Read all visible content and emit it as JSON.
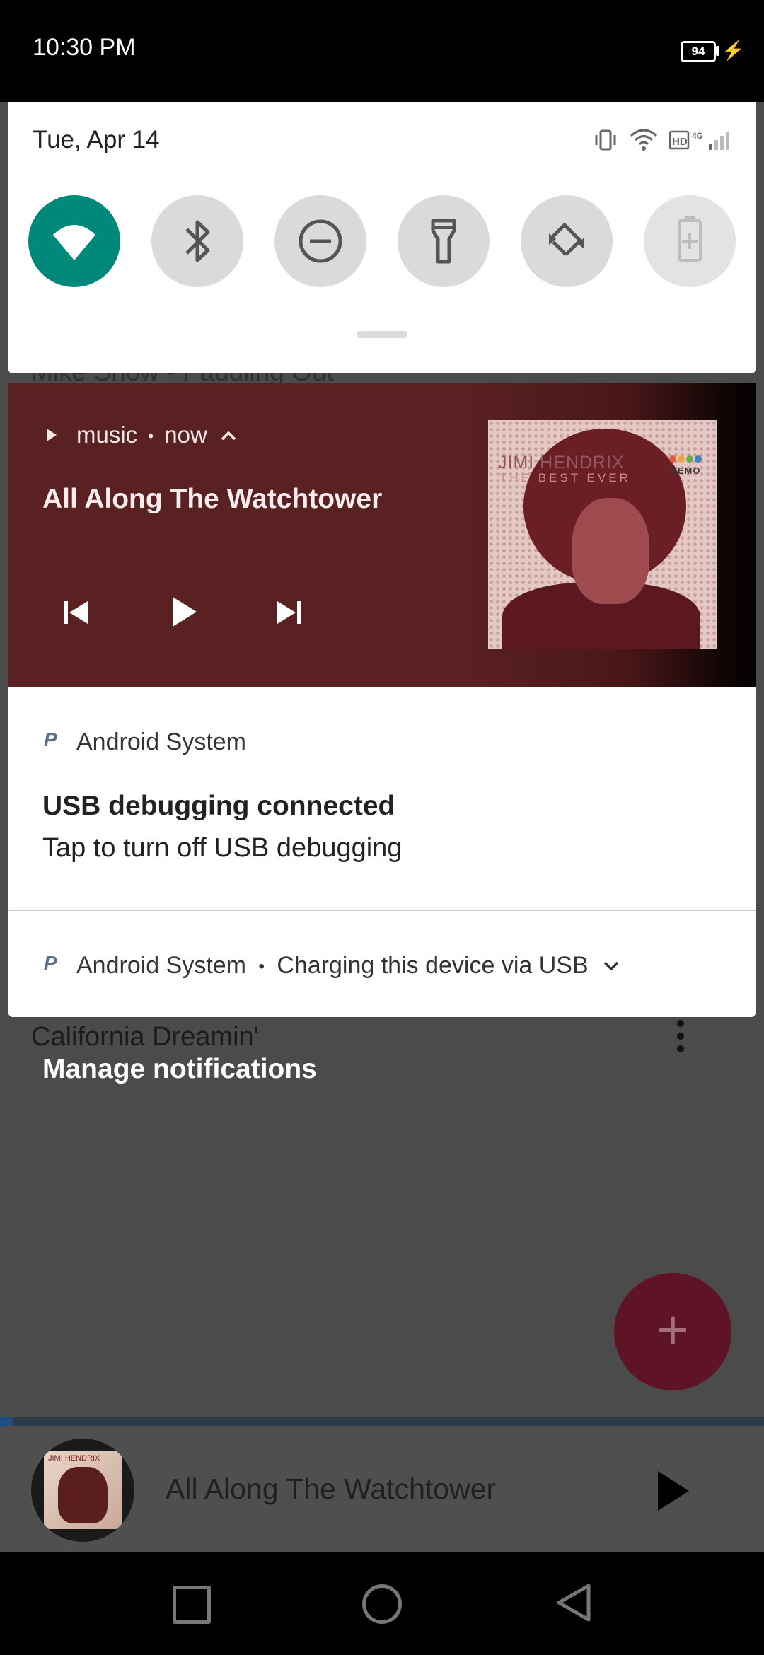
{
  "status_bar": {
    "time": "10:30 PM",
    "battery_level": "94",
    "icons": [
      "battery-icon",
      "charging-bolt-icon"
    ]
  },
  "quick_settings": {
    "date": "Tue, Apr 14",
    "status_icons": [
      "vibrate-icon",
      "wifi-icon",
      "hd-icon",
      "4g-icon",
      "signal-icon"
    ],
    "tiles": [
      {
        "name": "wifi",
        "icon": "wifi-icon",
        "active": true
      },
      {
        "name": "bluetooth",
        "icon": "bluetooth-icon",
        "active": false
      },
      {
        "name": "do-not-disturb",
        "icon": "dnd-icon",
        "active": false
      },
      {
        "name": "flashlight",
        "icon": "flashlight-icon",
        "active": false
      },
      {
        "name": "auto-rotate",
        "icon": "rotate-icon",
        "active": false
      },
      {
        "name": "battery-saver",
        "icon": "battery-saver-icon",
        "active": false
      }
    ],
    "colors": {
      "active_tile": "#00897b",
      "inactive_tile": "#dadada"
    }
  },
  "media_notification": {
    "app_name": "music",
    "separator": "•",
    "time": "now",
    "title": "All Along The Watchtower",
    "album_art": {
      "artist": "JIMI HENDRIX",
      "subtitle": "THE BEST EVER",
      "label": "MEMO"
    },
    "controls": [
      "previous-icon",
      "play-icon",
      "next-icon"
    ],
    "background_color": "#5a2122"
  },
  "usb_notification": {
    "app_name": "Android System",
    "title": "USB debugging connected",
    "text": "Tap to turn off USB debugging"
  },
  "charging_notification": {
    "app_name": "Android System",
    "separator": "•",
    "text": "Charging this device via USB"
  },
  "background_app": {
    "song_partial": "Mike Snow - Paddling Out",
    "song_2": "California Dreamin'",
    "manage_notifications": "Manage notifications",
    "fab_icon": "plus-icon",
    "fab_color": "#5f1326",
    "now_playing_title": "All Along The Watchtower"
  },
  "nav_bar": {
    "buttons": [
      "recents-icon",
      "home-icon",
      "back-icon"
    ]
  }
}
